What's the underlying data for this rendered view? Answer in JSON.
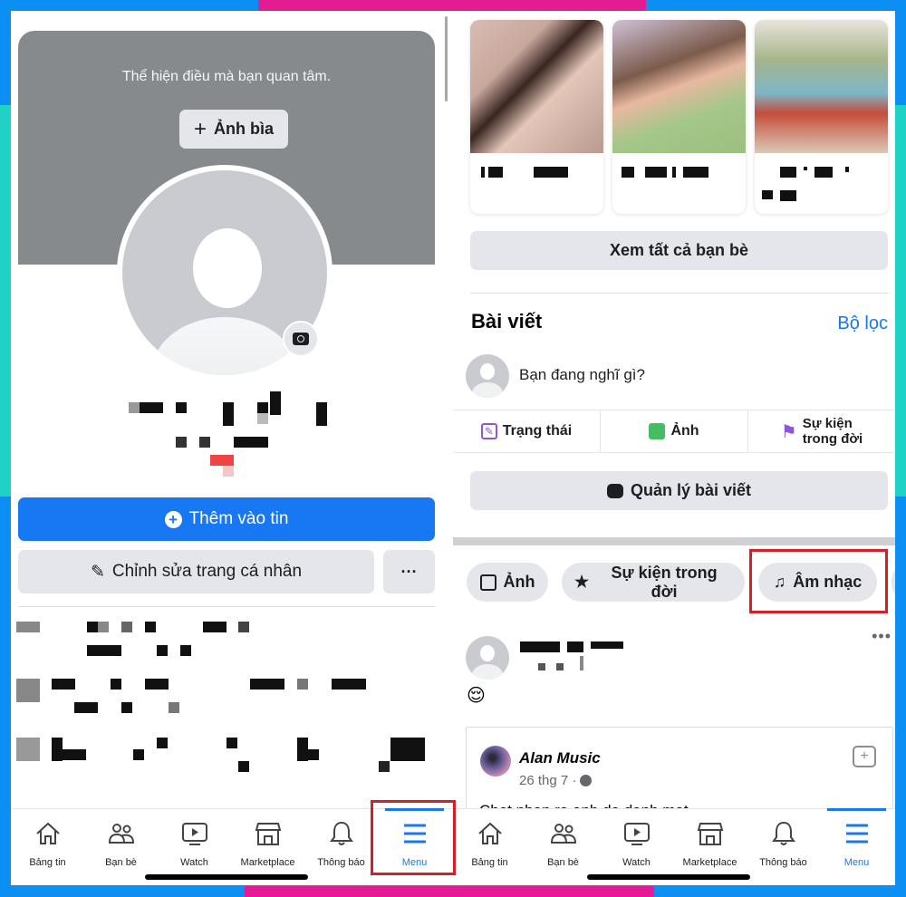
{
  "colors": {
    "frame_blue": "#0b8ff2",
    "frame_pink": "#e31c93",
    "frame_teal": "#1fd2c6",
    "fb_blue": "#1877f2",
    "highlight_red": "#d71d26"
  },
  "left_screen": {
    "cover": {
      "prompt": "Thể hiện điều mà bạn quan tâm.",
      "add_cover_label": "Ảnh bìa"
    },
    "buttons": {
      "add_to_story": "Thêm vào tin",
      "edit_profile": "Chỉnh sửa trang cá nhân",
      "more": "···"
    }
  },
  "right_screen": {
    "friends": {
      "see_all": "Xem tất cả bạn bè"
    },
    "posts": {
      "title": "Bài viết",
      "filter": "Bộ lọc",
      "composer_placeholder": "Bạn đang nghĩ gì?",
      "actions": [
        {
          "label": "Trạng thái",
          "icon": "edit-icon"
        },
        {
          "label": "Ảnh",
          "icon": "photo-icon"
        },
        {
          "label_line1": "Sự kiện",
          "label_line2": "trong đời",
          "icon": "flag-icon"
        }
      ],
      "manage_posts": "Quản lý bài viết"
    },
    "chips": [
      {
        "label": "Ảnh",
        "icon": "photo-icon"
      },
      {
        "label": "Sự kiện trong đời",
        "icon": "star-icon"
      },
      {
        "label": "Âm nhạc",
        "icon": "music-note-icon"
      }
    ],
    "post": {
      "more": "•••",
      "emoji": "😌",
      "shared": {
        "author": "Alan Music",
        "date": "26 thg 7 ·",
        "text": "Chot nhan ra anh da danh mat...."
      }
    }
  },
  "tabbar": {
    "items": [
      {
        "label": "Bảng tin",
        "icon": "home-icon"
      },
      {
        "label": "Bạn bè",
        "icon": "friends-icon"
      },
      {
        "label": "Watch",
        "icon": "watch-icon"
      },
      {
        "label": "Marketplace",
        "icon": "marketplace-icon"
      },
      {
        "label": "Thông báo",
        "icon": "bell-icon"
      },
      {
        "label": "Menu",
        "icon": "menu-icon",
        "active": true
      }
    ]
  }
}
